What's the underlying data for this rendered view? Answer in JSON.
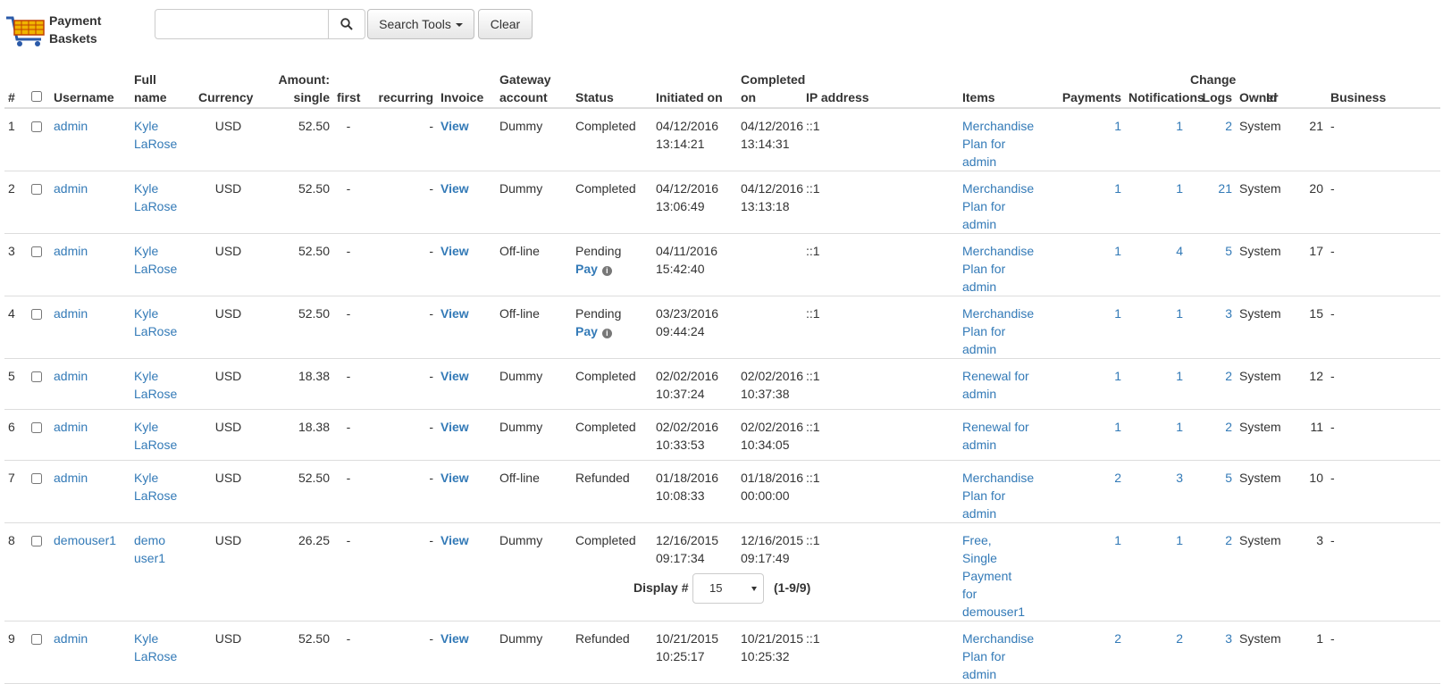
{
  "app": {
    "title": "Payment\nBaskets",
    "icon": "shopping-cart-icon"
  },
  "search": {
    "value": "",
    "placeholder": "",
    "icon": "search-icon"
  },
  "toolbar": {
    "search_tools_label": "Search Tools",
    "clear_label": "Clear"
  },
  "table": {
    "headers": {
      "num": "#",
      "username": "Username",
      "full_name": "Full name",
      "currency": "Currency",
      "amount_single": "Amount: single",
      "first": "first",
      "recurring": "recurring",
      "invoice": "Invoice",
      "gateway": "Gateway account",
      "status": "Status",
      "initiated": "Initiated on",
      "completed": "Completed on",
      "ip": "IP address",
      "items": "Items",
      "payments": "Payments",
      "notifications": "Notifications",
      "change_logs": "Change Logs",
      "owner": "Owner",
      "id": "Id",
      "business": "Business"
    },
    "rows": [
      {
        "num": "1",
        "username": "admin",
        "full_name": "Kyle LaRose",
        "currency": "USD",
        "single": "52.50",
        "first": "-",
        "recurring": "-",
        "invoice": "View",
        "gateway": "Dummy",
        "status": "Completed",
        "pay": "",
        "initiated": "04/12/2016 13:14:21",
        "completed": "04/12/2016 13:14:31",
        "ip": "::1",
        "items": "Merchandise Plan for admin",
        "payments": "1",
        "notifications": "1",
        "change_logs": "2",
        "owner": "System",
        "id": "21",
        "business": "-"
      },
      {
        "num": "2",
        "username": "admin",
        "full_name": "Kyle LaRose",
        "currency": "USD",
        "single": "52.50",
        "first": "-",
        "recurring": "-",
        "invoice": "View",
        "gateway": "Dummy",
        "status": "Completed",
        "pay": "",
        "initiated": "04/12/2016 13:06:49",
        "completed": "04/12/2016 13:13:18",
        "ip": "::1",
        "items": "Merchandise Plan for admin",
        "payments": "1",
        "notifications": "1",
        "change_logs": "21",
        "owner": "System",
        "id": "20",
        "business": "-"
      },
      {
        "num": "3",
        "username": "admin",
        "full_name": "Kyle LaRose",
        "currency": "USD",
        "single": "52.50",
        "first": "-",
        "recurring": "-",
        "invoice": "View",
        "gateway": "Off-line",
        "status": "Pending",
        "pay": "Pay",
        "initiated": "04/11/2016 15:42:40",
        "completed": "",
        "ip": "::1",
        "items": "Merchandise Plan for admin",
        "payments": "1",
        "notifications": "4",
        "change_logs": "5",
        "owner": "System",
        "id": "17",
        "business": "-"
      },
      {
        "num": "4",
        "username": "admin",
        "full_name": "Kyle LaRose",
        "currency": "USD",
        "single": "52.50",
        "first": "-",
        "recurring": "-",
        "invoice": "View",
        "gateway": "Off-line",
        "status": "Pending",
        "pay": "Pay",
        "initiated": "03/23/2016 09:44:24",
        "completed": "",
        "ip": "::1",
        "items": "Merchandise Plan for admin",
        "payments": "1",
        "notifications": "1",
        "change_logs": "3",
        "owner": "System",
        "id": "15",
        "business": "-"
      },
      {
        "num": "5",
        "username": "admin",
        "full_name": "Kyle LaRose",
        "currency": "USD",
        "single": "18.38",
        "first": "-",
        "recurring": "-",
        "invoice": "View",
        "gateway": "Dummy",
        "status": "Completed",
        "pay": "",
        "initiated": "02/02/2016 10:37:24",
        "completed": "02/02/2016 10:37:38",
        "ip": "::1",
        "items": "Renewal for admin",
        "payments": "1",
        "notifications": "1",
        "change_logs": "2",
        "owner": "System",
        "id": "12",
        "business": "-"
      },
      {
        "num": "6",
        "username": "admin",
        "full_name": "Kyle LaRose",
        "currency": "USD",
        "single": "18.38",
        "first": "-",
        "recurring": "-",
        "invoice": "View",
        "gateway": "Dummy",
        "status": "Completed",
        "pay": "",
        "initiated": "02/02/2016 10:33:53",
        "completed": "02/02/2016 10:34:05",
        "ip": "::1",
        "items": "Renewal for admin",
        "payments": "1",
        "notifications": "1",
        "change_logs": "2",
        "owner": "System",
        "id": "11",
        "business": "-"
      },
      {
        "num": "7",
        "username": "admin",
        "full_name": "Kyle LaRose",
        "currency": "USD",
        "single": "52.50",
        "first": "-",
        "recurring": "-",
        "invoice": "View",
        "gateway": "Off-line",
        "status": "Refunded",
        "pay": "",
        "initiated": "01/18/2016 10:08:33",
        "completed": "01/18/2016 00:00:00",
        "ip": "::1",
        "items": "Merchandise Plan for admin",
        "payments": "2",
        "notifications": "3",
        "change_logs": "5",
        "owner": "System",
        "id": "10",
        "business": "-"
      },
      {
        "num": "8",
        "username": "demouser1",
        "full_name": "demo user1",
        "currency": "USD",
        "single": "26.25",
        "first": "-",
        "recurring": "-",
        "invoice": "View",
        "gateway": "Dummy",
        "status": "Completed",
        "pay": "",
        "initiated": "12/16/2015 09:17:34",
        "completed": "12/16/2015 09:17:49",
        "ip": "::1",
        "items": "Free, Single Payment for demouser1",
        "payments": "1",
        "notifications": "1",
        "change_logs": "2",
        "owner": "System",
        "id": "3",
        "business": "-"
      },
      {
        "num": "9",
        "username": "admin",
        "full_name": "Kyle LaRose",
        "currency": "USD",
        "single": "52.50",
        "first": "-",
        "recurring": "-",
        "invoice": "View",
        "gateway": "Dummy",
        "status": "Refunded",
        "pay": "",
        "initiated": "10/21/2015 10:25:17",
        "completed": "10/21/2015 10:25:32",
        "ip": "::1",
        "items": "Merchandise Plan for admin",
        "payments": "2",
        "notifications": "2",
        "change_logs": "3",
        "owner": "System",
        "id": "1",
        "business": "-"
      }
    ]
  },
  "footer": {
    "display_label": "Display #",
    "display_value": "15",
    "range": "(1-9/9)"
  }
}
